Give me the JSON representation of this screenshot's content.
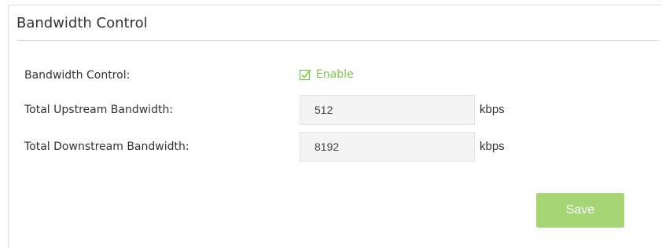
{
  "section": {
    "title": "Bandwidth Control"
  },
  "form": {
    "bandwidth_control": {
      "label": "Bandwidth Control:",
      "checkbox_label": "Enable",
      "checked": true
    },
    "upstream": {
      "label": "Total Upstream Bandwidth:",
      "value": "512",
      "unit": "kbps"
    },
    "downstream": {
      "label": "Total Downstream Bandwidth:",
      "value": "8192",
      "unit": "kbps"
    }
  },
  "actions": {
    "save_label": "Save"
  },
  "colors": {
    "accent": "#7dc54b",
    "save_button_bg": "#a5d574",
    "input_bg": "#f4f4f4",
    "divider": "#d9d9d9"
  },
  "icons": {
    "checkbox": "checkbox-checked-icon"
  }
}
